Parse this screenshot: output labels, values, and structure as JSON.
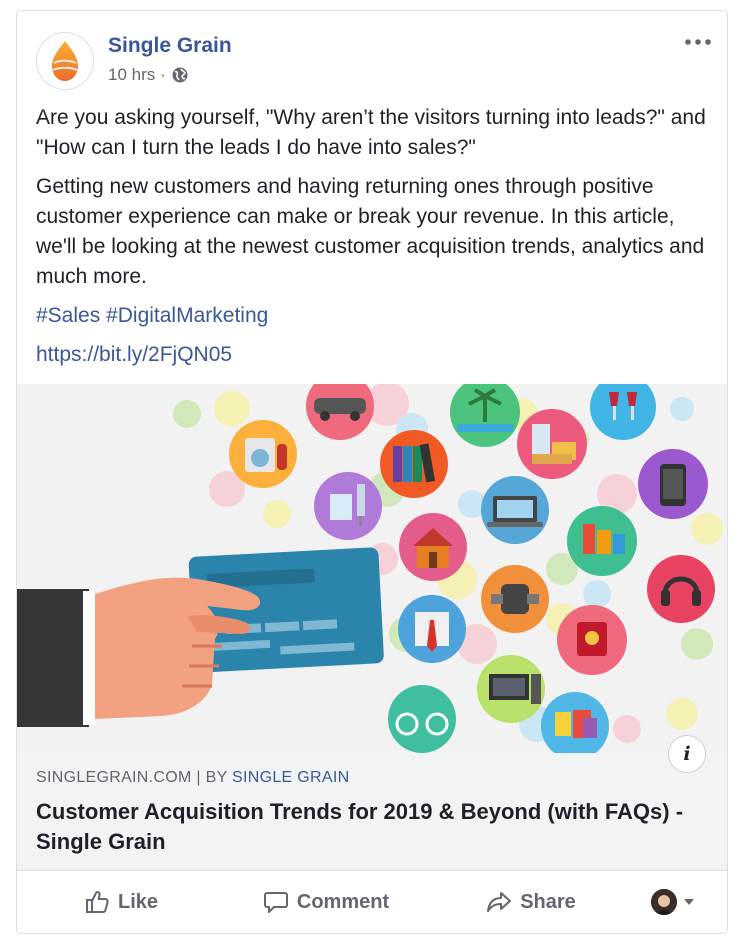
{
  "post": {
    "page_name": "Single Grain",
    "time": "10 hrs",
    "separator": "·",
    "privacy_icon": "globe-icon",
    "paragraph1": "Are you asking yourself, \"Why aren’t the visitors turning into leads?\" and \"How can I turn the leads I do have into sales?\"",
    "paragraph2": "Getting new customers and having returning ones through positive customer experience can make or break your revenue. In this article, we'll be looking at the newest customer acquisition trends, analytics and much more.",
    "hashtags": [
      "#Sales",
      "#DigitalMarketing"
    ],
    "link": "https://bit.ly/2FjQN05"
  },
  "preview": {
    "domain": "SINGLEGRAIN.COM",
    "separator": "|",
    "by_label": "BY",
    "author": "SINGLE GRAIN",
    "title": "Customer Acquisition Trends for 2019 & Beyond (with FAQs) - Single Grain",
    "info_icon_label": "i"
  },
  "actions": {
    "like": "Like",
    "comment": "Comment",
    "share": "Share"
  },
  "colors": {
    "brand_blue": "#385898",
    "muted": "#606770",
    "logo_orange": "#f7931e"
  }
}
